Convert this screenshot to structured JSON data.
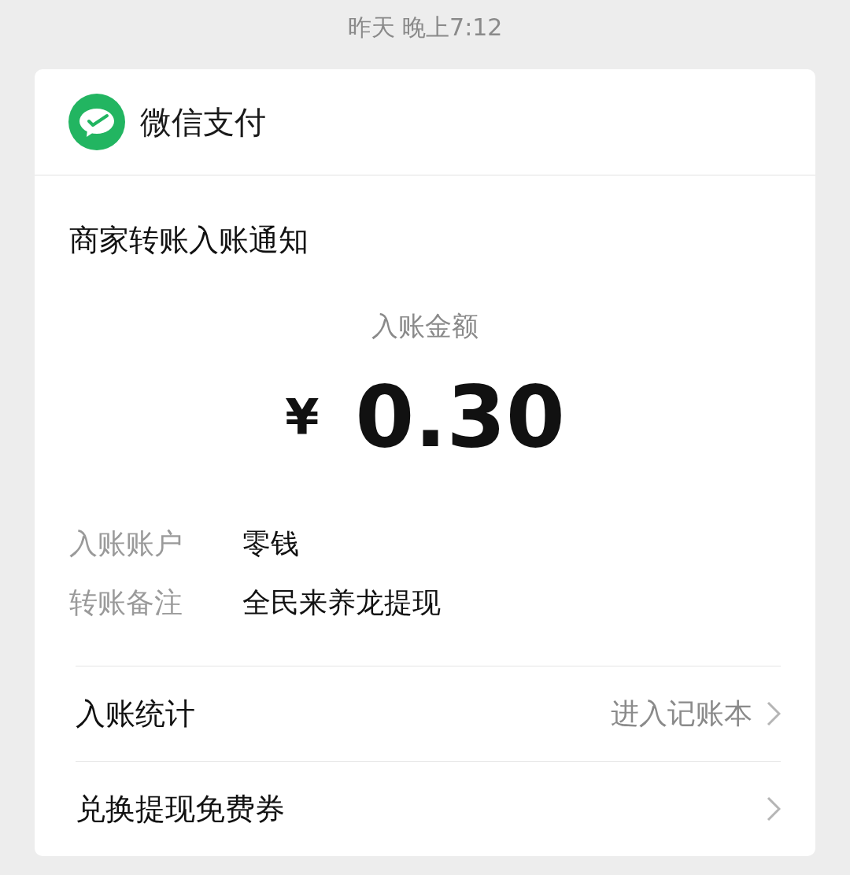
{
  "timestamp": "昨天 晚上7:12",
  "card": {
    "app_name": "微信支付",
    "title": "商家转账入账通知",
    "amount": {
      "label": "入账金额",
      "currency": "¥",
      "value": "0.30"
    },
    "details": [
      {
        "label": "入账账户",
        "value": "零钱"
      },
      {
        "label": "转账备注",
        "value": "全民来养龙提现"
      }
    ],
    "links": [
      {
        "label": "入账统计",
        "hint": "进入记账本"
      },
      {
        "label": "兑换提现免费券"
      }
    ]
  }
}
